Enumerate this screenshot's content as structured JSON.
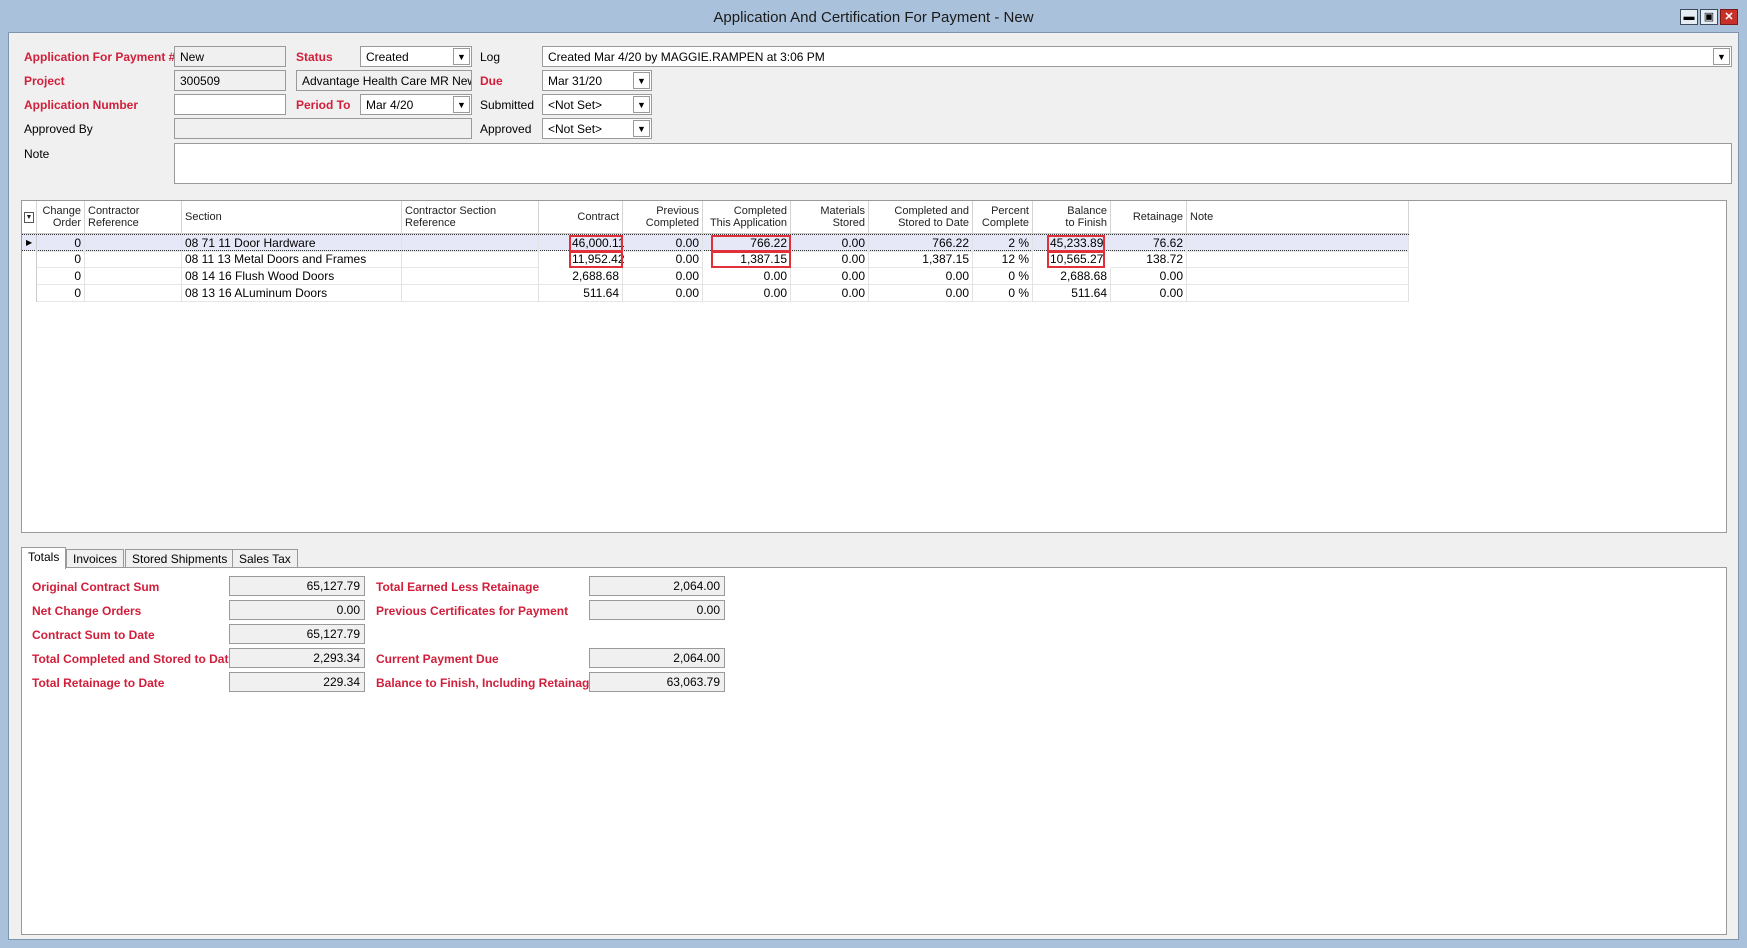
{
  "window": {
    "title": "Application And Certification For Payment - New",
    "minimize": "▬",
    "restore": "▣",
    "close": "✕"
  },
  "header": {
    "app_for_payment_label": "Application For Payment #",
    "app_for_payment_value": "New",
    "status_label": "Status",
    "status_value": "Created",
    "log_label": "Log",
    "log_value": "Created Mar 4/20 by MAGGIE.RAMPEN at 3:06 PM",
    "project_label": "Project",
    "project_number": "300509",
    "project_name": "Advantage Health Care MR New",
    "due_label": "Due",
    "due_value": "Mar 31/20",
    "application_number_label": "Application Number",
    "application_number_value": "",
    "period_to_label": "Period To",
    "period_to_value": "Mar 4/20",
    "submitted_label": "Submitted",
    "submitted_value": "<Not Set>",
    "approved_by_label": "Approved By",
    "approved_by_value": "",
    "approved_label": "Approved",
    "approved_value": "<Not Set>",
    "note_label": "Note",
    "note_value": ""
  },
  "grid": {
    "columns": {
      "change_order": [
        "Change",
        "Order"
      ],
      "contractor_reference": [
        "Contractor",
        "Reference"
      ],
      "section": "Section",
      "contractor_section_reference": [
        "Contractor Section",
        "Reference"
      ],
      "contract": "Contract",
      "previous_completed": [
        "Previous",
        "Completed"
      ],
      "completed_this_application": [
        "Completed",
        "This Application"
      ],
      "materials_stored": [
        "Materials",
        "Stored"
      ],
      "completed_and_stored": [
        "Completed and",
        "Stored to Date"
      ],
      "percent_complete": [
        "Percent",
        "Complete"
      ],
      "balance_to_finish": [
        "Balance",
        "to Finish"
      ],
      "retainage": "Retainage",
      "note": "Note"
    },
    "rows": [
      {
        "change_order": "0",
        "contractor_reference": "",
        "section": "08 71 11 Door Hardware",
        "contractor_section_reference": "",
        "contract": "46,000.11",
        "previous_completed": "0.00",
        "completed_this_application": "766.22",
        "materials_stored": "0.00",
        "completed_and_stored": "766.22",
        "percent_complete": "2 %",
        "balance_to_finish": "45,233.89",
        "retainage": "76.62",
        "note": ""
      },
      {
        "change_order": "0",
        "contractor_reference": "",
        "section": "08 11 13 Metal Doors and Frames",
        "contractor_section_reference": "",
        "contract": "11,952.42",
        "previous_completed": "0.00",
        "completed_this_application": "1,387.15",
        "materials_stored": "0.00",
        "completed_and_stored": "1,387.15",
        "percent_complete": "12 %",
        "balance_to_finish": "10,565.27",
        "retainage": "138.72",
        "note": ""
      },
      {
        "change_order": "0",
        "contractor_reference": "",
        "section": "08 14 16 Flush Wood Doors",
        "contractor_section_reference": "",
        "contract": "2,688.68",
        "previous_completed": "0.00",
        "completed_this_application": "0.00",
        "materials_stored": "0.00",
        "completed_and_stored": "0.00",
        "percent_complete": "0 %",
        "balance_to_finish": "2,688.68",
        "retainage": "0.00",
        "note": ""
      },
      {
        "change_order": "0",
        "contractor_reference": "",
        "section": "08 13 16 ALuminum Doors",
        "contractor_section_reference": "",
        "contract": "511.64",
        "previous_completed": "0.00",
        "completed_this_application": "0.00",
        "materials_stored": "0.00",
        "completed_and_stored": "0.00",
        "percent_complete": "0 %",
        "balance_to_finish": "511.64",
        "retainage": "0.00",
        "note": ""
      }
    ]
  },
  "tabs": [
    "Totals",
    "Invoices",
    "Stored Shipments",
    "Sales Tax"
  ],
  "totals": {
    "original_contract_sum_label": "Original Contract Sum",
    "original_contract_sum": "65,127.79",
    "net_change_orders_label": "Net Change Orders",
    "net_change_orders": "0.00",
    "contract_sum_to_date_label": "Contract Sum to Date",
    "contract_sum_to_date": "65,127.79",
    "total_completed_stored_label": "Total Completed and Stored to Date",
    "total_completed_stored": "2,293.34",
    "total_retainage_label": "Total Retainage to Date",
    "total_retainage": "229.34",
    "total_earned_less_retainage_label": "Total Earned Less Retainage",
    "total_earned_less_retainage": "2,064.00",
    "previous_certificates_label": "Previous Certificates for Payment",
    "previous_certificates": "0.00",
    "current_payment_due_label": "Current Payment Due",
    "current_payment_due": "2,064.00",
    "balance_to_finish_incl_label": "Balance to Finish, Including Retainage",
    "balance_to_finish_incl": "63,063.79"
  },
  "colors": {
    "required_label": "#d11f3b",
    "highlight_box": "#e0303a",
    "selected_row": "#e6e7f7"
  },
  "icons": {
    "dropdown": "chevron-down-icon",
    "row_indicator": "current-row-icon",
    "column_chooser": "column-chooser-icon"
  }
}
